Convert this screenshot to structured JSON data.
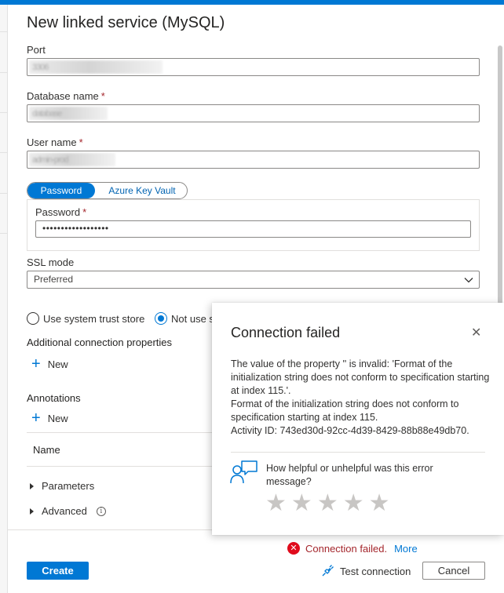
{
  "dialog": {
    "title": "New linked service (MySQL)"
  },
  "port": {
    "label": "Port",
    "value": "3306"
  },
  "database": {
    "label": "Database name",
    "required": "*",
    "value": "database"
  },
  "username": {
    "label": "User name",
    "required": "*",
    "value": "admin-prod"
  },
  "auth_toggle": {
    "option_a": "Password",
    "option_b": "Azure Key Vault"
  },
  "password": {
    "label": "Password",
    "required": "*",
    "value": "••••••••••••••••••"
  },
  "ssl": {
    "label": "SSL mode",
    "value": "Preferred"
  },
  "trust": {
    "option_a": "Use system trust store",
    "option_b": "Not use s"
  },
  "additional": {
    "label": "Additional connection properties",
    "new_label": "New"
  },
  "annotations": {
    "label": "Annotations",
    "new_label": "New",
    "column": "Name"
  },
  "parameters": {
    "label": "Parameters"
  },
  "advanced": {
    "label": "Advanced",
    "info_glyph": "i"
  },
  "footer": {
    "error_text": "Connection failed.",
    "error_more": "More",
    "create_label": "Create",
    "test_label": "Test connection",
    "cancel_label": "Cancel"
  },
  "popup": {
    "title": "Connection failed",
    "close_glyph": "✕",
    "message_line1": "The value of the property '' is invalid: 'Format of the initialization string does not conform to specification starting at index 115.'.",
    "message_line2": "Format of the initialization string does not conform to specification starting at index 115.",
    "message_line3": "Activity ID: 743ed30d-92cc-4d39-8429-88b88e49db70.",
    "feedback_prompt": "How helpful or unhelpful was this error message?",
    "star_glyph": "★",
    "rating": 0,
    "rating_max": 5
  },
  "colors": {
    "accent": "#0078d4",
    "error": "#a4262c",
    "error_icon": "#e00b1c",
    "star_empty": "#c8c6c4"
  }
}
